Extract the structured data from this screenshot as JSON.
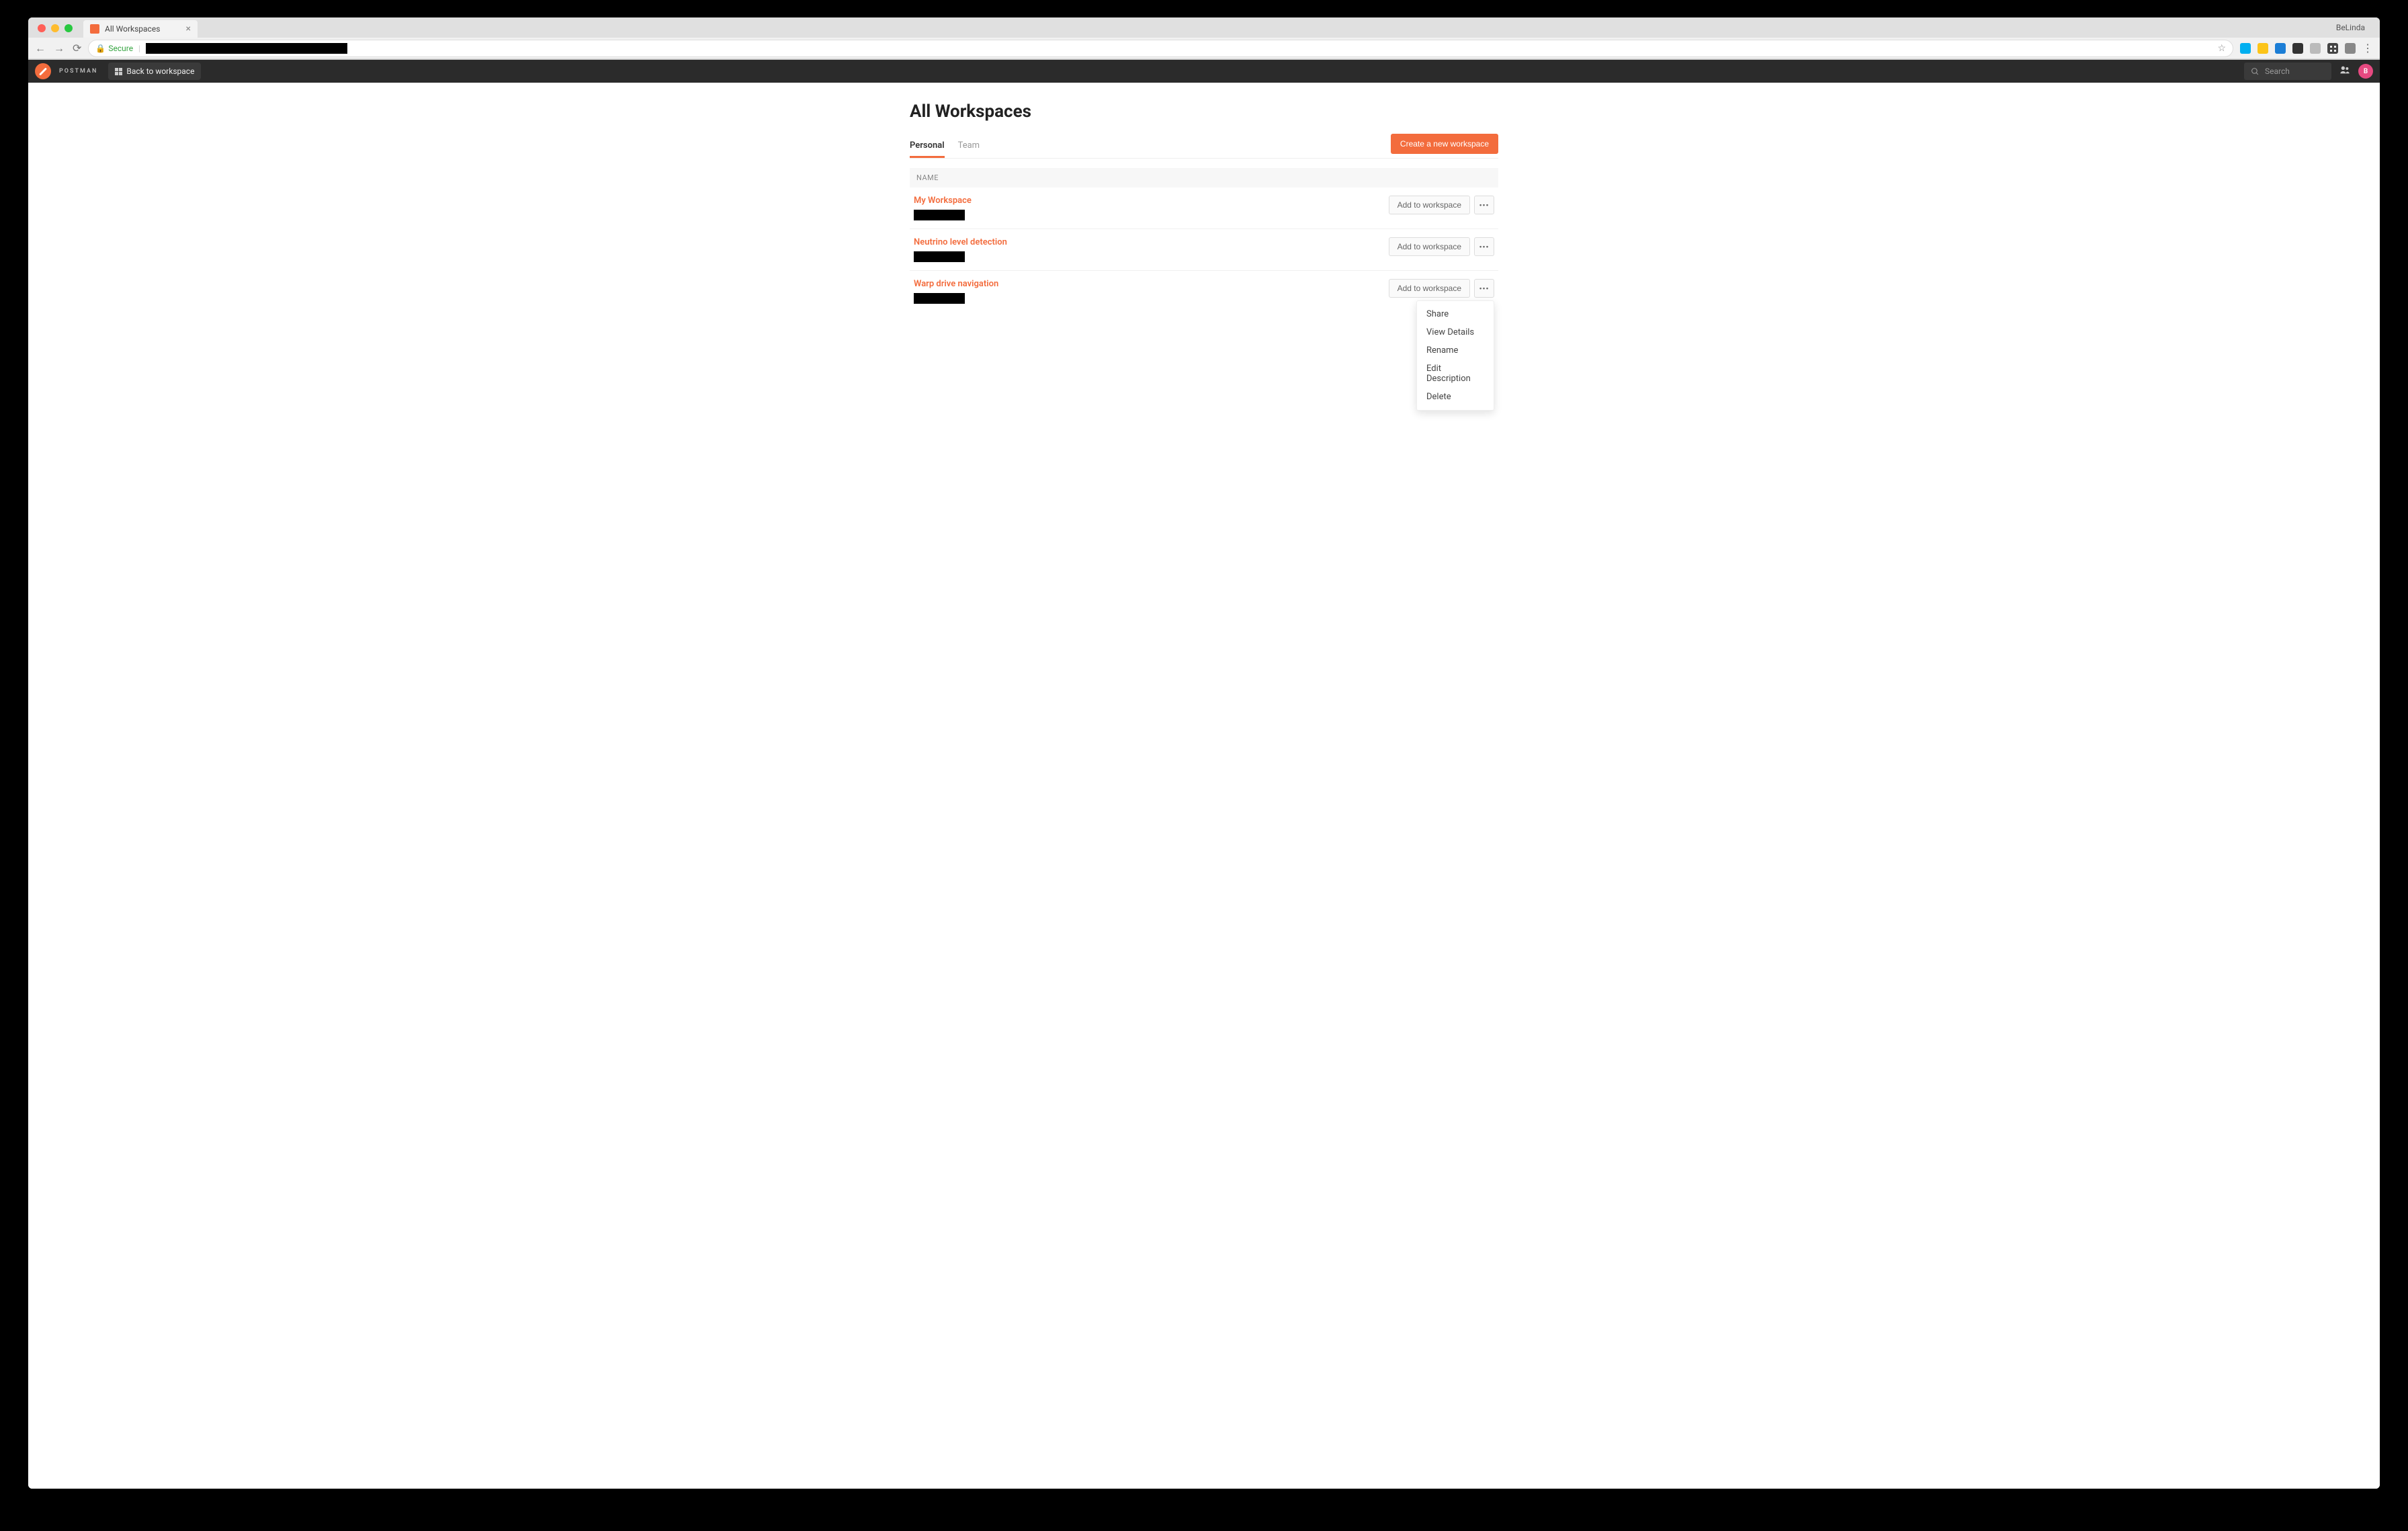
{
  "browser": {
    "tab_title": "All Workspaces",
    "user_name": "BeLinda",
    "secure_label": "Secure"
  },
  "header": {
    "brand": "POSTMAN",
    "back_label": "Back to workspace",
    "search_placeholder": "Search",
    "avatar_initial": "B"
  },
  "page": {
    "title": "All Workspaces",
    "tabs": [
      {
        "label": "Personal",
        "active": true
      },
      {
        "label": "Team",
        "active": false
      }
    ],
    "create_button": "Create a new workspace",
    "table_header": "NAME",
    "add_button_label": "Add to workspace"
  },
  "workspaces": [
    {
      "name": "My Workspace"
    },
    {
      "name": "Neutrino level detection"
    },
    {
      "name": "Warp drive navigation"
    }
  ],
  "dropdown": {
    "items": [
      "Share",
      "View Details",
      "Rename",
      "Edit Description",
      "Delete"
    ]
  }
}
